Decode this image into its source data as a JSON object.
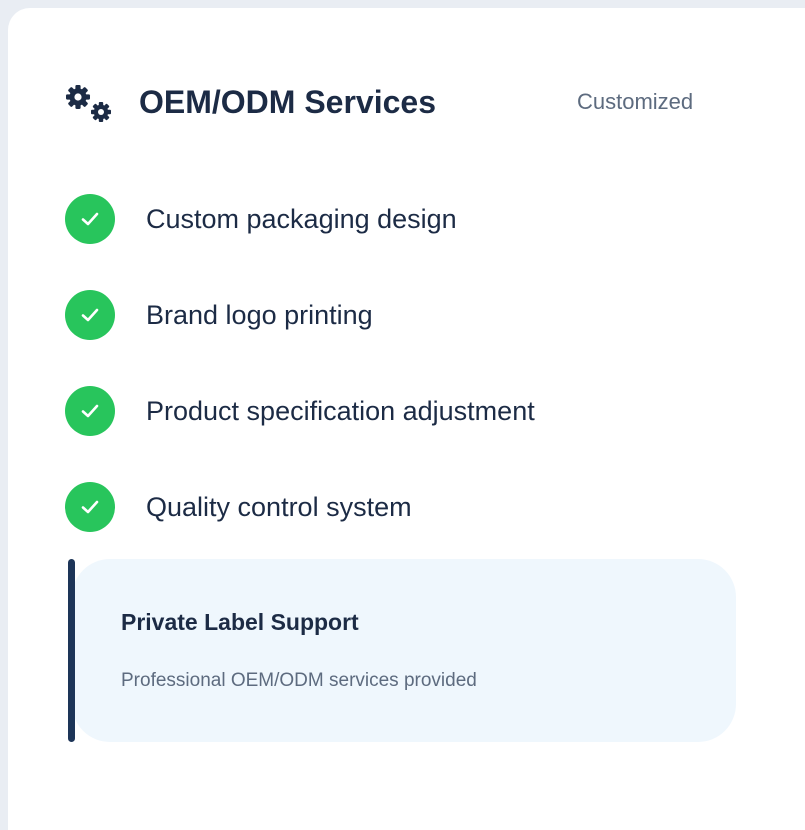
{
  "header": {
    "icon": "gears-icon",
    "title": "OEM/ODM Services",
    "badge": "Customized"
  },
  "features": [
    {
      "icon": "check-circle-icon",
      "label": "Custom packaging design"
    },
    {
      "icon": "check-circle-icon",
      "label": "Brand logo printing"
    },
    {
      "icon": "check-circle-icon",
      "label": "Product specification adjustment"
    },
    {
      "icon": "check-circle-icon",
      "label": "Quality control system"
    }
  ],
  "callout": {
    "title": "Private Label Support",
    "description": "Professional OEM/ODM services provided"
  },
  "colors": {
    "primary_text": "#1c2b45",
    "muted_text": "#5d6b7f",
    "check_green": "#28c55c",
    "accent_navy": "#1d3558",
    "callout_bg": "#eff7fd"
  }
}
